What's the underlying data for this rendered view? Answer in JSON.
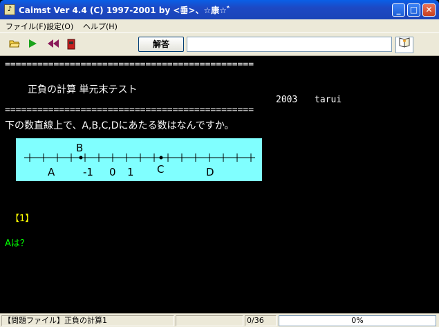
{
  "window": {
    "title": "Caimst Ver 4.4 (C) 1997-2001  by <垂>、☆康☆゛",
    "minimize": "_",
    "maximize": "□",
    "close": "✕"
  },
  "menu": {
    "file": "ファイル(F)",
    "settings": "設定(O)",
    "help": "ヘルプ(H)"
  },
  "toolbar": {
    "answer_label": "解答",
    "answer_value": "",
    "icons": [
      "open-folder-icon",
      "play-icon",
      "rewind-icon",
      "stop-icon",
      "help-book-icon"
    ]
  },
  "content": {
    "separator": "==============================================",
    "heading": "正負の計算  単元末テスト",
    "year": "2003",
    "author": "tarui",
    "instruction": "下の数直線上で、A,B,C,Dにあたる数はなんですか。",
    "numline": {
      "label_B": "B",
      "label_A": "A",
      "label_m1": "-1",
      "label_0": "0",
      "label_1": "1",
      "label_C": "C",
      "label_D": "D",
      "bg_color": "#80ffff"
    },
    "question_number": "【1】",
    "question_text": "Aは？"
  },
  "status": {
    "problem_file": "【問題ファイル】正負の計算1",
    "counter": "0/36",
    "progress": "0%"
  }
}
